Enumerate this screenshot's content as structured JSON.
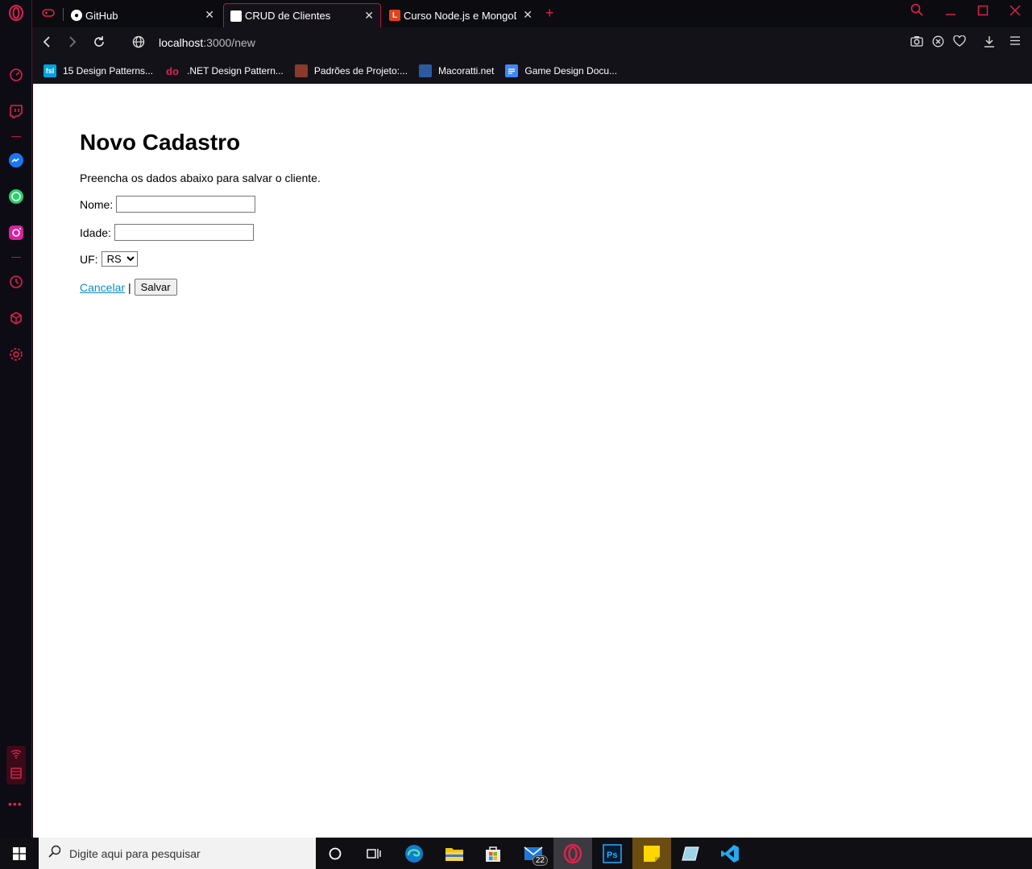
{
  "browser": {
    "tabs": [
      {
        "title": "GitHub"
      },
      {
        "title": "CRUD de Clientes"
      },
      {
        "title": "Curso Node.js e MongoDB"
      }
    ],
    "url_host": "localhost",
    "url_path": ":3000/new",
    "bookmarks": [
      {
        "icon": "fsl",
        "label": "15 Design Patterns..."
      },
      {
        "icon": "do",
        "label": ".NET Design Pattern..."
      },
      {
        "icon": "",
        "label": "Padrões de Projeto:..."
      },
      {
        "icon": "",
        "label": "Macoratti.net"
      },
      {
        "icon": "",
        "label": "Game Design Docu..."
      }
    ]
  },
  "page": {
    "title": "Novo Cadastro",
    "intro": "Preencha os dados abaixo para salvar o cliente.",
    "name_label": "Nome:",
    "name_value": "",
    "age_label": "Idade:",
    "age_value": "",
    "uf_label": "UF:",
    "uf_selected": "RS",
    "cancel_label": "Cancelar",
    "separator": "|",
    "save_label": "Salvar"
  },
  "taskbar": {
    "search_placeholder": "Digite aqui para pesquisar",
    "mail_badge": "22"
  },
  "colors": {
    "accent": "#e0234e",
    "link": "#0b8bd0"
  }
}
